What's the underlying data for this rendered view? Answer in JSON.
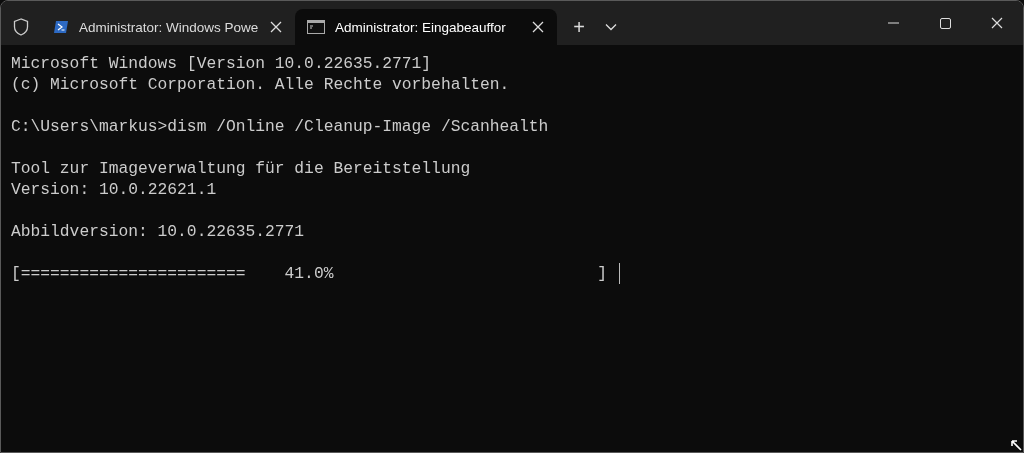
{
  "tabs": [
    {
      "title": "Administrator: Windows Powe",
      "kind": "powershell",
      "selected": false
    },
    {
      "title": "Administrator: Eingabeauffor",
      "kind": "cmd",
      "selected": true
    }
  ],
  "new_tab": "+",
  "terminal": {
    "blocks": [
      [
        "Microsoft Windows [Version 10.0.22635.2771]",
        "(c) Microsoft Corporation. Alle Rechte vorbehalten."
      ],
      [
        "C:\\Users\\markus>dism /Online /Cleanup-Image /Scanhealth"
      ],
      [
        "Tool zur Imageverwaltung für die Bereitstellung",
        "Version: 10.0.22621.1"
      ],
      [
        "Abbildversion: 10.0.22635.2771"
      ],
      [
        "[=======================    41.0%                           ]"
      ]
    ]
  }
}
